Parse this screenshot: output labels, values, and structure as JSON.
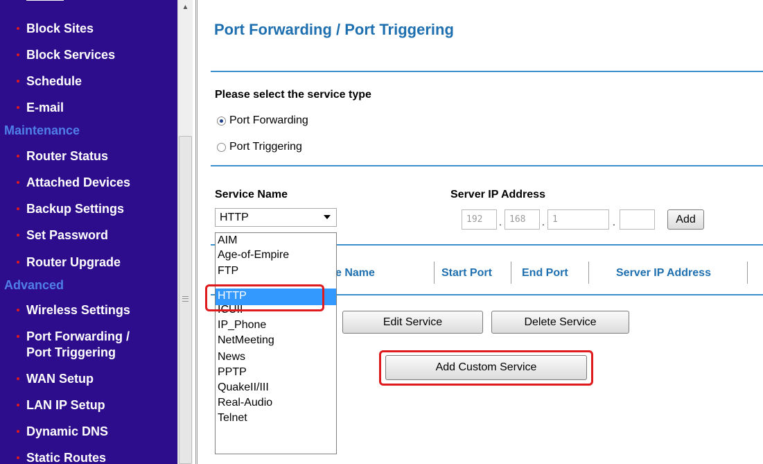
{
  "sidebar": {
    "items": [
      {
        "label": "Block Sites",
        "kind": "item"
      },
      {
        "label": "Block Services",
        "kind": "item"
      },
      {
        "label": "Schedule",
        "kind": "item"
      },
      {
        "label": "E-mail",
        "kind": "item"
      },
      {
        "label": "Maintenance",
        "kind": "heading"
      },
      {
        "label": "Router Status",
        "kind": "item"
      },
      {
        "label": "Attached Devices",
        "kind": "item"
      },
      {
        "label": "Backup Settings",
        "kind": "item"
      },
      {
        "label": "Set Password",
        "kind": "item"
      },
      {
        "label": "Router Upgrade",
        "kind": "item"
      },
      {
        "label": "Advanced",
        "kind": "heading"
      },
      {
        "label": "Wireless Settings",
        "kind": "item"
      },
      {
        "label": "Port Forwarding /",
        "label2": "Port Triggering",
        "kind": "item"
      },
      {
        "label": "WAN Setup",
        "kind": "item"
      },
      {
        "label": "LAN IP Setup",
        "kind": "item"
      },
      {
        "label": "Dynamic DNS",
        "kind": "item"
      },
      {
        "label": "Static Routes",
        "kind": "item"
      }
    ]
  },
  "main": {
    "title": "Port Forwarding / Port Triggering",
    "service_type_prompt": "Please select the service type",
    "radio_options": [
      {
        "label": "Port Forwarding",
        "checked": true
      },
      {
        "label": "Port Triggering",
        "checked": false
      }
    ],
    "service_name_label": "Service Name",
    "server_ip_label": "Server IP Address",
    "service_select_value": "HTTP",
    "ip_octets": [
      "192",
      "168",
      "1",
      ""
    ],
    "add_button": "Add",
    "table_headers": [
      "e Name",
      "Start Port",
      "End Port",
      "Server IP Address"
    ],
    "edit_button": "Edit Service",
    "delete_button": "Delete Service",
    "add_custom_button": "Add Custom Service",
    "dropdown_options": [
      "AIM",
      "Age-of-Empire",
      "FTP",
      "HTTP",
      "ICUII",
      "IP_Phone",
      "NetMeeting",
      "News",
      "PPTP",
      "QuakeII/III",
      "Real-Audio",
      "Telnet"
    ],
    "dropdown_selected": "HTTP"
  },
  "colors": {
    "sidebar_bg": "#2e0d8d",
    "sidebar_heading": "#4f7fe8",
    "bullet": "#e0191d",
    "title_blue": "#1d6fb0",
    "rule_blue": "#3b8fcb",
    "highlight_red": "#e0191d",
    "selected_option": "#3399ff"
  }
}
